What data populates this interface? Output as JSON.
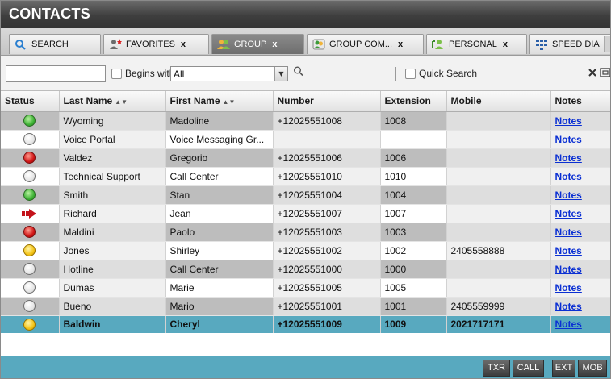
{
  "window": {
    "title": "CONTACTS"
  },
  "tabs": [
    {
      "label": "SEARCH",
      "icon": "search-icon",
      "closable": false,
      "active": false
    },
    {
      "label": "FAVORITES",
      "icon": "favorites-icon",
      "closable": true,
      "close_label": "x",
      "active": false
    },
    {
      "label": "GROUP",
      "icon": "group-icon",
      "closable": true,
      "close_label": "x",
      "active": true
    },
    {
      "label": "GROUP COM...",
      "icon": "group-common-icon",
      "closable": true,
      "close_label": "x",
      "active": false
    },
    {
      "label": "PERSONAL",
      "icon": "personal-icon",
      "closable": true,
      "close_label": "x",
      "active": false
    },
    {
      "label": "SPEED DIA",
      "icon": "speed-dial-icon",
      "closable": false,
      "active": false
    }
  ],
  "filter": {
    "search_value": "",
    "begins_with_label": "Begins with",
    "begins_with_checked": false,
    "dropdown_value": "All",
    "quick_search_label": "Quick Search",
    "quick_search_checked": false
  },
  "table": {
    "columns": [
      {
        "label": "Status",
        "sortable": false
      },
      {
        "label": "Last Name",
        "sortable": true
      },
      {
        "label": "First Name",
        "sortable": true
      },
      {
        "label": "Number",
        "sortable": false
      },
      {
        "label": "Extension",
        "sortable": false
      },
      {
        "label": "Mobile",
        "sortable": false
      },
      {
        "label": "Notes",
        "sortable": false
      }
    ],
    "rows": [
      {
        "status": "green",
        "last": "Wyoming",
        "first": "Madoline",
        "number": "+12025551008",
        "ext": "1008",
        "mobile": "",
        "notes": "Notes"
      },
      {
        "status": "white",
        "last": "Voice Portal",
        "first": "Voice Messaging Gr...",
        "number": "",
        "ext": "",
        "mobile": "",
        "notes": "Notes"
      },
      {
        "status": "red",
        "last": "Valdez",
        "first": "Gregorio",
        "number": "+12025551006",
        "ext": "1006",
        "mobile": "",
        "notes": "Notes"
      },
      {
        "status": "white",
        "last": "Technical Support",
        "first": "Call Center",
        "number": "+12025551010",
        "ext": "1010",
        "mobile": "",
        "notes": "Notes"
      },
      {
        "status": "green",
        "last": "Smith",
        "first": "Stan",
        "number": "+12025551004",
        "ext": "1004",
        "mobile": "",
        "notes": "Notes"
      },
      {
        "status": "forward",
        "last": "Richard",
        "first": "Jean",
        "number": "+12025551007",
        "ext": "1007",
        "mobile": "",
        "notes": "Notes"
      },
      {
        "status": "red",
        "last": "Maldini",
        "first": "Paolo",
        "number": "+12025551003",
        "ext": "1003",
        "mobile": "",
        "notes": "Notes"
      },
      {
        "status": "yellow",
        "last": "Jones",
        "first": "Shirley",
        "number": "+12025551002",
        "ext": "1002",
        "mobile": "2405558888",
        "notes": "Notes"
      },
      {
        "status": "white",
        "last": "Hotline",
        "first": "Call Center",
        "number": "+12025551000",
        "ext": "1000",
        "mobile": "",
        "notes": "Notes"
      },
      {
        "status": "white",
        "last": "Dumas",
        "first": "Marie",
        "number": "+12025551005",
        "ext": "1005",
        "mobile": "",
        "notes": "Notes"
      },
      {
        "status": "white",
        "last": "Bueno",
        "first": "Mario",
        "number": "+12025551001",
        "ext": "1001",
        "mobile": "2405559999",
        "notes": "Notes"
      },
      {
        "status": "yellow",
        "last": "Baldwin",
        "first": "Cheryl",
        "number": "+12025551009",
        "ext": "1009",
        "mobile": "2021717171",
        "notes": "Notes",
        "selected": true
      }
    ]
  },
  "actions": [
    {
      "label": "TXR",
      "name": "transfer-button"
    },
    {
      "label": "CALL",
      "name": "call-button"
    },
    {
      "label": "EXT",
      "name": "call-extension-button"
    },
    {
      "label": "MOB",
      "name": "call-mobile-button"
    }
  ],
  "colors": {
    "title_bar": "#3e3e3e",
    "selected_row": "#58a9bf",
    "link": "#0a2fd3",
    "status_green": "#3fb336",
    "status_red": "#d11616",
    "status_yellow": "#f4c417",
    "forward_red": "#c4131b"
  }
}
